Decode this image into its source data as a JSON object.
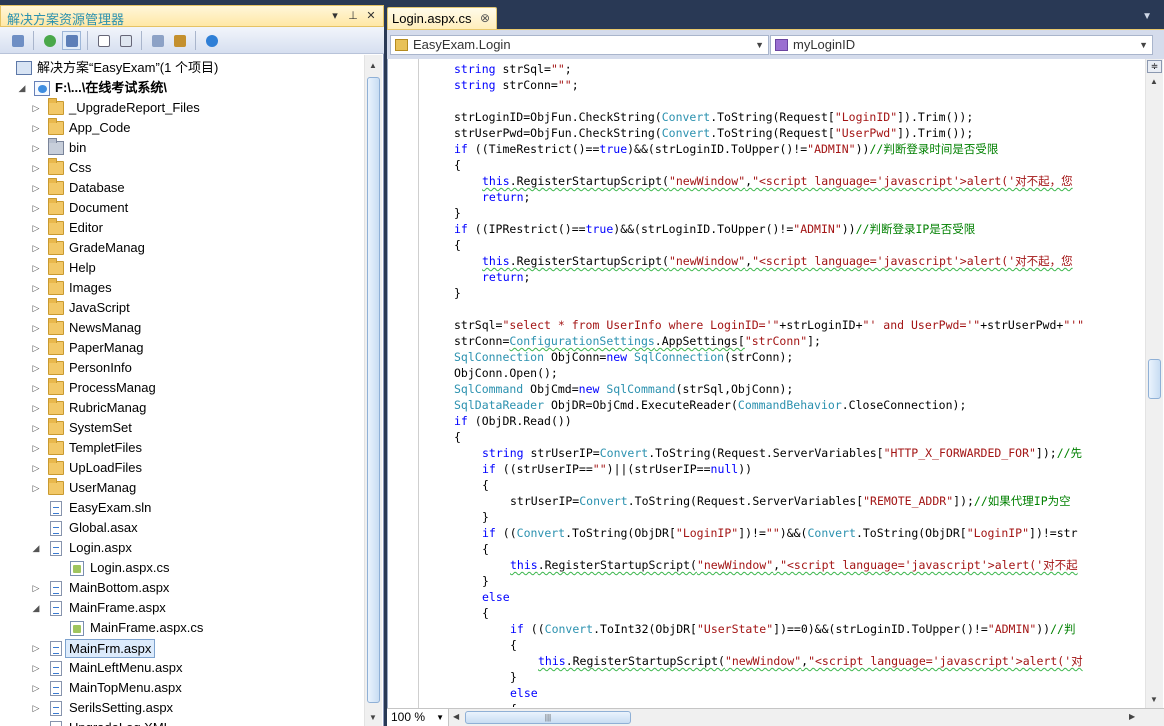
{
  "solution_explorer": {
    "title": "解决方案资源管理器",
    "title_buttons": [
      "▾",
      "⊥",
      "✕"
    ],
    "solution_label": "解决方案“EasyExam”(1 个项目)",
    "project_label": "F:\\...\\在线考试系统\\",
    "items": [
      {
        "label": "_UpgradeReport_Files",
        "type": "folder",
        "expander": "▷"
      },
      {
        "label": "App_Code",
        "type": "folder",
        "expander": "▷"
      },
      {
        "label": "bin",
        "type": "bin",
        "expander": "▷"
      },
      {
        "label": "Css",
        "type": "folder",
        "expander": "▷"
      },
      {
        "label": "Database",
        "type": "folder",
        "expander": "▷"
      },
      {
        "label": "Document",
        "type": "folder",
        "expander": "▷"
      },
      {
        "label": "Editor",
        "type": "folder",
        "expander": "▷"
      },
      {
        "label": "GradeManag",
        "type": "folder",
        "expander": "▷"
      },
      {
        "label": "Help",
        "type": "folder",
        "expander": "▷"
      },
      {
        "label": "Images",
        "type": "folder",
        "expander": "▷"
      },
      {
        "label": "JavaScript",
        "type": "folder",
        "expander": "▷"
      },
      {
        "label": "NewsManag",
        "type": "folder",
        "expander": "▷"
      },
      {
        "label": "PaperManag",
        "type": "folder",
        "expander": "▷"
      },
      {
        "label": "PersonInfo",
        "type": "folder",
        "expander": "▷"
      },
      {
        "label": "ProcessManag",
        "type": "folder",
        "expander": "▷"
      },
      {
        "label": "RubricManag",
        "type": "folder",
        "expander": "▷"
      },
      {
        "label": "SystemSet",
        "type": "folder",
        "expander": "▷"
      },
      {
        "label": "TempletFiles",
        "type": "folder",
        "expander": "▷"
      },
      {
        "label": "UpLoadFiles",
        "type": "folder",
        "expander": "▷"
      },
      {
        "label": "UserManag",
        "type": "folder",
        "expander": "▷"
      },
      {
        "label": "EasyExam.sln",
        "type": "sln",
        "expander": ""
      },
      {
        "label": "Global.asax",
        "type": "page",
        "expander": ""
      },
      {
        "label": "Login.aspx",
        "type": "web",
        "expander": "◢"
      },
      {
        "label": "Login.aspx.cs",
        "type": "cs",
        "expander": "",
        "child": true
      },
      {
        "label": "MainBottom.aspx",
        "type": "web",
        "expander": "▷"
      },
      {
        "label": "MainFrame.aspx",
        "type": "web",
        "expander": "◢"
      },
      {
        "label": "MainFrame.aspx.cs",
        "type": "cs",
        "expander": "",
        "child": true
      },
      {
        "label": "MainFrm.aspx",
        "type": "web",
        "expander": "▷",
        "selected": true
      },
      {
        "label": "MainLeftMenu.aspx",
        "type": "web",
        "expander": "▷"
      },
      {
        "label": "MainTopMenu.aspx",
        "type": "web",
        "expander": "▷"
      },
      {
        "label": "SerilsSetting.aspx",
        "type": "web",
        "expander": "▷"
      },
      {
        "label": "UpgradeLog.XML",
        "type": "page",
        "expander": ""
      }
    ]
  },
  "editor": {
    "tab_label": "Login.aspx.cs",
    "tab_close": "⊗",
    "class_combo": "EasyExam.Login",
    "member_combo": "myLoginID",
    "zoom": "100 %",
    "code_lines": [
      {
        "indent": 0,
        "tokens": [
          [
            "k",
            "string"
          ],
          [
            "",
            "strSql="
          ],
          [
            "s",
            "\"\""
          ],
          [
            "",
            ";"
          ]
        ]
      },
      {
        "indent": 0,
        "tokens": [
          [
            "k",
            "string"
          ],
          [
            "",
            "strConn="
          ],
          [
            "s",
            "\"\""
          ],
          [
            "",
            ";"
          ]
        ]
      },
      {
        "indent": 0,
        "tokens": []
      },
      {
        "indent": 0,
        "tokens": [
          [
            "",
            "strLoginID=ObjFun.CheckString("
          ],
          [
            "t",
            "Convert"
          ],
          [
            "",
            ".ToString(Request["
          ],
          [
            "s",
            "\"LoginID\""
          ],
          [
            "",
            "]).Trim());"
          ]
        ]
      },
      {
        "indent": 0,
        "tokens": [
          [
            "",
            "strUserPwd=ObjFun.CheckString("
          ],
          [
            "t",
            "Convert"
          ],
          [
            "",
            ".ToString(Request["
          ],
          [
            "s",
            "\"UserPwd\""
          ],
          [
            "",
            "]).Trim());"
          ]
        ]
      },
      {
        "indent": 0,
        "tokens": [
          [
            "k",
            "if"
          ],
          [
            "",
            " ((TimeRestrict()=="
          ],
          [
            "k",
            "true"
          ],
          [
            "",
            ")&&(strLoginID.ToUpper()!="
          ],
          [
            "s",
            "\"ADMIN\""
          ],
          [
            "",
            "))"
          ],
          [
            "c",
            "//判断登录时间是否受限"
          ]
        ]
      },
      {
        "indent": 0,
        "tokens": [
          [
            "",
            "{"
          ]
        ]
      },
      {
        "indent": 4,
        "tokens": [
          [
            "kw",
            "this"
          ],
          [
            "w",
            ".RegisterStartupScript("
          ],
          [
            "sw",
            "\"newWindow\""
          ],
          [
            "w",
            ","
          ],
          [
            "sw",
            "\"<script language='javascript'>alert('对不起，您"
          ]
        ]
      },
      {
        "indent": 4,
        "tokens": [
          [
            "k",
            "return"
          ],
          [
            "",
            ";"
          ]
        ]
      },
      {
        "indent": 0,
        "tokens": [
          [
            "",
            "}"
          ]
        ]
      },
      {
        "indent": 0,
        "tokens": [
          [
            "k",
            "if"
          ],
          [
            "",
            " ((IPRestrict()=="
          ],
          [
            "k",
            "true"
          ],
          [
            "",
            ")&&(strLoginID.ToUpper()!="
          ],
          [
            "s",
            "\"ADMIN\""
          ],
          [
            "",
            "))"
          ],
          [
            "c",
            "//判断登录IP是否受限"
          ]
        ]
      },
      {
        "indent": 0,
        "tokens": [
          [
            "",
            "{"
          ]
        ]
      },
      {
        "indent": 4,
        "tokens": [
          [
            "kw",
            "this"
          ],
          [
            "w",
            ".RegisterStartupScript("
          ],
          [
            "sw",
            "\"newWindow\""
          ],
          [
            "w",
            ","
          ],
          [
            "sw",
            "\"<script language='javascript'>alert('对不起，您"
          ]
        ]
      },
      {
        "indent": 4,
        "tokens": [
          [
            "k",
            "return"
          ],
          [
            "",
            ";"
          ]
        ]
      },
      {
        "indent": 0,
        "tokens": [
          [
            "",
            "}"
          ]
        ]
      },
      {
        "indent": 0,
        "tokens": []
      },
      {
        "indent": 0,
        "tokens": [
          [
            "",
            "strSql="
          ],
          [
            "s",
            "\"select * from UserInfo where LoginID='\""
          ],
          [
            "",
            "+strLoginID+"
          ],
          [
            "s",
            "\"' and UserPwd='\""
          ],
          [
            "",
            "+strUserPwd+"
          ],
          [
            "s",
            "\"'\""
          ]
        ]
      },
      {
        "indent": 0,
        "tokens": [
          [
            "",
            "strConn="
          ],
          [
            "tw",
            "ConfigurationSettings"
          ],
          [
            "w",
            ".AppSettings["
          ],
          [
            "s",
            "\"strConn\""
          ],
          [
            "",
            "];"
          ]
        ]
      },
      {
        "indent": 0,
        "tokens": [
          [
            "t",
            "SqlConnection"
          ],
          [
            "",
            " ObjConn="
          ],
          [
            "k",
            "new"
          ],
          [
            "",
            " "
          ],
          [
            "t",
            "SqlConnection"
          ],
          [
            "",
            "(strConn);"
          ]
        ]
      },
      {
        "indent": 0,
        "tokens": [
          [
            "",
            "ObjConn.Open();"
          ]
        ]
      },
      {
        "indent": 0,
        "tokens": [
          [
            "t",
            "SqlCommand"
          ],
          [
            "",
            " ObjCmd="
          ],
          [
            "k",
            "new"
          ],
          [
            "",
            " "
          ],
          [
            "t",
            "SqlCommand"
          ],
          [
            "",
            "(strSql,ObjConn);"
          ]
        ]
      },
      {
        "indent": 0,
        "tokens": [
          [
            "t",
            "SqlDataReader"
          ],
          [
            "",
            " ObjDR=ObjCmd.ExecuteReader("
          ],
          [
            "t",
            "CommandBehavior"
          ],
          [
            "",
            ".CloseConnection);"
          ]
        ]
      },
      {
        "indent": 0,
        "tokens": [
          [
            "k",
            "if"
          ],
          [
            "",
            " (ObjDR.Read())"
          ]
        ]
      },
      {
        "indent": 0,
        "tokens": [
          [
            "",
            "{"
          ]
        ]
      },
      {
        "indent": 4,
        "tokens": [
          [
            "k",
            "string"
          ],
          [
            "",
            " strUserIP="
          ],
          [
            "t",
            "Convert"
          ],
          [
            "",
            ".ToString(Request.ServerVariables["
          ],
          [
            "s",
            "\"HTTP_X_FORWARDED_FOR\""
          ],
          [
            "",
            "]);"
          ],
          [
            "c",
            "//先"
          ]
        ]
      },
      {
        "indent": 4,
        "tokens": [
          [
            "k",
            "if"
          ],
          [
            "",
            " ((strUserIP=="
          ],
          [
            "s",
            "\"\""
          ],
          [
            "",
            ")||(strUserIP=="
          ],
          [
            "k",
            "null"
          ],
          [
            "",
            "))"
          ]
        ]
      },
      {
        "indent": 4,
        "tokens": [
          [
            "",
            "{"
          ]
        ]
      },
      {
        "indent": 8,
        "tokens": [
          [
            "",
            "strUserIP="
          ],
          [
            "t",
            "Convert"
          ],
          [
            "",
            ".ToString(Request.ServerVariables["
          ],
          [
            "s",
            "\"REMOTE_ADDR\""
          ],
          [
            "",
            "]);"
          ],
          [
            "c",
            "//如果代理IP为空"
          ]
        ]
      },
      {
        "indent": 4,
        "tokens": [
          [
            "",
            "}"
          ]
        ]
      },
      {
        "indent": 4,
        "tokens": [
          [
            "k",
            "if"
          ],
          [
            "",
            " (("
          ],
          [
            "t",
            "Convert"
          ],
          [
            "",
            ".ToString(ObjDR["
          ],
          [
            "s",
            "\"LoginIP\""
          ],
          [
            "",
            "])!="
          ],
          [
            "s",
            "\"\""
          ],
          [
            "",
            ")&&("
          ],
          [
            "t",
            "Convert"
          ],
          [
            "",
            ".ToString(ObjDR["
          ],
          [
            "s",
            "\"LoginIP\""
          ],
          [
            "",
            "])!=str"
          ]
        ]
      },
      {
        "indent": 4,
        "tokens": [
          [
            "",
            "{"
          ]
        ]
      },
      {
        "indent": 8,
        "tokens": [
          [
            "kw",
            "this"
          ],
          [
            "w",
            ".RegisterStartupScript("
          ],
          [
            "sw",
            "\"newWindow\""
          ],
          [
            "w",
            ","
          ],
          [
            "sw",
            "\"<script language='javascript'>alert('对不起"
          ]
        ]
      },
      {
        "indent": 4,
        "tokens": [
          [
            "",
            "}"
          ]
        ]
      },
      {
        "indent": 4,
        "tokens": [
          [
            "k",
            "else"
          ]
        ]
      },
      {
        "indent": 4,
        "tokens": [
          [
            "",
            "{"
          ]
        ]
      },
      {
        "indent": 8,
        "tokens": [
          [
            "k",
            "if"
          ],
          [
            "",
            " (("
          ],
          [
            "t",
            "Convert"
          ],
          [
            "",
            ".ToInt32(ObjDR["
          ],
          [
            "s",
            "\"UserState\""
          ],
          [
            "",
            "])==0)&&(strLoginID.ToUpper()!="
          ],
          [
            "s",
            "\"ADMIN\""
          ],
          [
            "",
            "))"
          ],
          [
            "c",
            "//判"
          ]
        ]
      },
      {
        "indent": 8,
        "tokens": [
          [
            "",
            "{"
          ]
        ]
      },
      {
        "indent": 12,
        "tokens": [
          [
            "kw",
            "this"
          ],
          [
            "w",
            ".RegisterStartupScript("
          ],
          [
            "sw",
            "\"newWindow\""
          ],
          [
            "w",
            ","
          ],
          [
            "sw",
            "\"<script language='javascript'>alert('对"
          ]
        ]
      },
      {
        "indent": 8,
        "tokens": [
          [
            "",
            "}"
          ]
        ]
      },
      {
        "indent": 8,
        "tokens": [
          [
            "k",
            "else"
          ]
        ]
      },
      {
        "indent": 8,
        "tokens": [
          [
            "",
            "{"
          ]
        ]
      }
    ]
  }
}
